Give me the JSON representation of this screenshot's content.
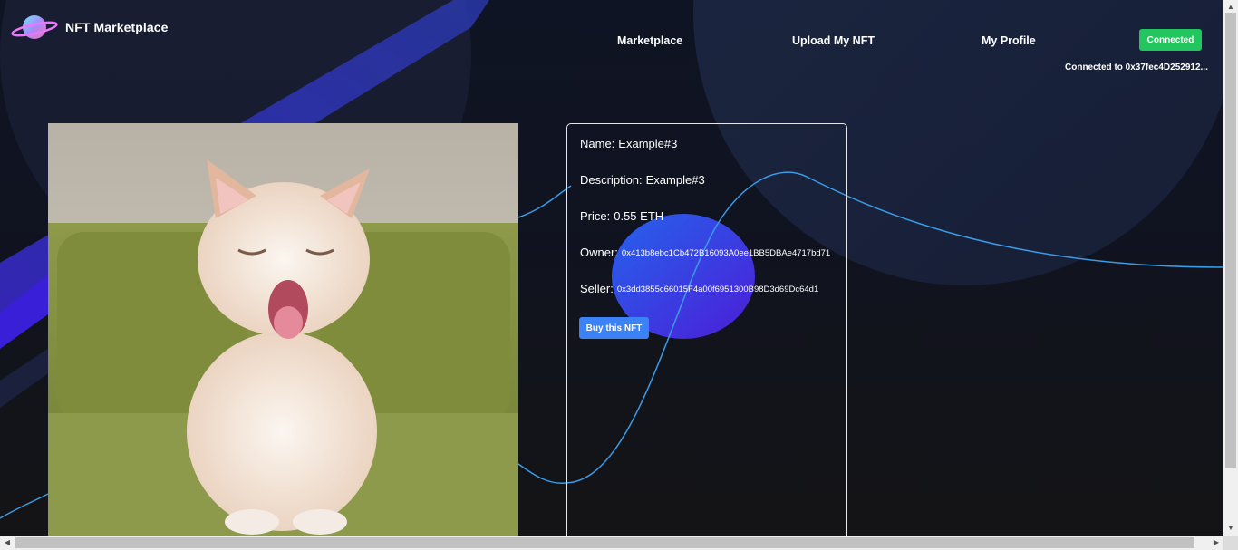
{
  "brand": {
    "title": "NFT Marketplace"
  },
  "nav": {
    "links": [
      "Marketplace",
      "Upload My NFT",
      "My Profile"
    ],
    "connect_button": "Connected",
    "connected_text": "Connected to 0x37fec4D252912..."
  },
  "nft": {
    "image_alt": "kitten",
    "name_label": "Name:",
    "name": "Example#3",
    "description_label": "Description:",
    "description": "Example#3",
    "price_label": "Price:",
    "price": "0.55 ETH",
    "owner_label": "Owner:",
    "owner": "0x413b8ebc1Cb472B16093A0ee1BB5DBAe4717bd71",
    "seller_label": "Seller:",
    "seller": "0x3dd3855c66015F4a00f6951300B98D3d69Dc64d1",
    "buy_button": "Buy this NFT"
  },
  "colors": {
    "connect_button": "#22c55e",
    "buy_button": "#3b82f6",
    "background": "#141416",
    "accent_blue": "#3b82f6",
    "accent_purple": "#4f1fd8"
  }
}
